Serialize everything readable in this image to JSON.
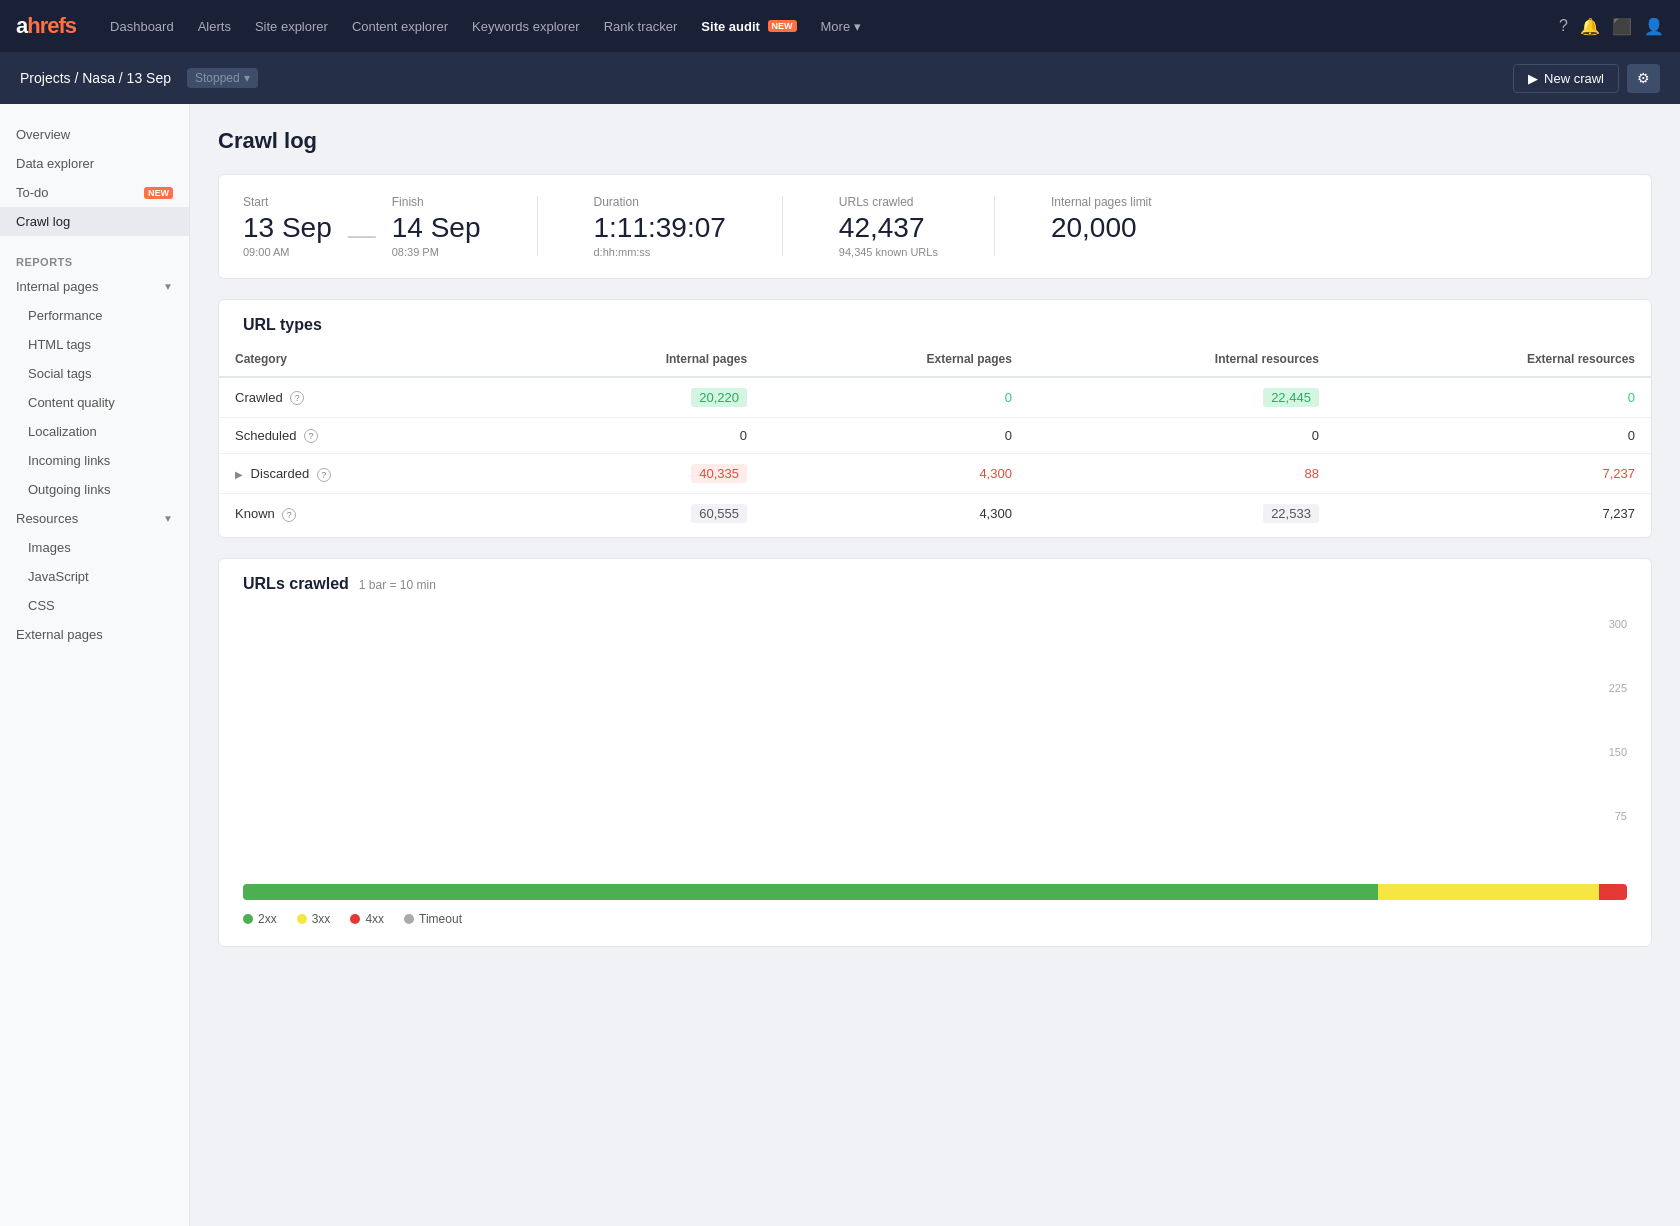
{
  "nav": {
    "logo": "ahrefs",
    "links": [
      {
        "label": "Dashboard",
        "active": false
      },
      {
        "label": "Alerts",
        "active": false
      },
      {
        "label": "Site explorer",
        "active": false
      },
      {
        "label": "Content explorer",
        "active": false
      },
      {
        "label": "Keywords explorer",
        "active": false
      },
      {
        "label": "Rank tracker",
        "active": false
      },
      {
        "label": "Site audit",
        "active": true,
        "badge": "NEW"
      },
      {
        "label": "More",
        "active": false,
        "hasArrow": true
      }
    ]
  },
  "subheader": {
    "breadcrumb_projects": "Projects",
    "breadcrumb_sep1": " / ",
    "breadcrumb_nasa": "Nasa",
    "breadcrumb_sep2": " / ",
    "breadcrumb_date": "13 Sep",
    "status": "Stopped",
    "new_crawl_label": "New crawl",
    "settings_icon": "⚙"
  },
  "sidebar": {
    "items": [
      {
        "label": "Overview",
        "type": "item"
      },
      {
        "label": "Data explorer",
        "type": "item"
      },
      {
        "label": "To-do",
        "type": "item",
        "badge": "NEW"
      },
      {
        "label": "Crawl log",
        "type": "item",
        "active": true
      },
      {
        "label": "REPORTS",
        "type": "section"
      },
      {
        "label": "Internal pages",
        "type": "group",
        "expanded": true
      },
      {
        "label": "Performance",
        "type": "subitem"
      },
      {
        "label": "HTML tags",
        "type": "subitem"
      },
      {
        "label": "Social tags",
        "type": "subitem"
      },
      {
        "label": "Content quality",
        "type": "subitem"
      },
      {
        "label": "Localization",
        "type": "subitem"
      },
      {
        "label": "Incoming links",
        "type": "subitem"
      },
      {
        "label": "Outgoing links",
        "type": "subitem"
      },
      {
        "label": "Resources",
        "type": "group",
        "expanded": true
      },
      {
        "label": "Images",
        "type": "subitem"
      },
      {
        "label": "JavaScript",
        "type": "subitem"
      },
      {
        "label": "CSS",
        "type": "subitem"
      },
      {
        "label": "External pages",
        "type": "item"
      }
    ]
  },
  "page": {
    "title": "Crawl log",
    "crawl_stats": {
      "start_label": "Start",
      "start_value": "13 Sep",
      "start_time": "09:00 AM",
      "dash": "—",
      "finish_label": "Finish",
      "finish_value": "14 Sep",
      "finish_time": "08:39 PM",
      "duration_label": "Duration",
      "duration_value": "1:11:39:07",
      "duration_sub": "d:hh:mm:ss",
      "urls_label": "URLs crawled",
      "urls_value": "42,437",
      "urls_sub": "94,345 known URLs",
      "limit_label": "Internal pages limit",
      "limit_value": "20,000"
    },
    "url_types": {
      "title": "URL types",
      "columns": [
        "Category",
        "Internal pages",
        "External pages",
        "Internal resources",
        "External resources"
      ],
      "rows": [
        {
          "category": "Crawled",
          "internal_pages": "20,220",
          "internal_pages_style": "green-light",
          "external_pages": "0",
          "external_pages_style": "green",
          "internal_resources": "22,445",
          "internal_resources_style": "green-light",
          "external_resources": "0",
          "external_resources_style": "green"
        },
        {
          "category": "Scheduled",
          "internal_pages": "0",
          "internal_pages_style": "normal",
          "external_pages": "0",
          "external_pages_style": "normal",
          "internal_resources": "0",
          "internal_resources_style": "normal",
          "external_resources": "0",
          "external_resources_style": "normal"
        },
        {
          "category": "Discarded",
          "expandable": true,
          "internal_pages": "40,335",
          "internal_pages_style": "red-bg",
          "external_pages": "4,300",
          "external_pages_style": "red",
          "internal_resources": "88",
          "internal_resources_style": "red",
          "external_resources": "7,237",
          "external_resources_style": "red"
        },
        {
          "category": "Known",
          "internal_pages": "60,555",
          "internal_pages_style": "gray-bg",
          "external_pages": "4,300",
          "external_pages_style": "normal",
          "internal_resources": "22,533",
          "internal_resources_style": "gray-bg",
          "external_resources": "7,237",
          "external_resources_style": "normal"
        }
      ]
    },
    "chart": {
      "title": "URLs crawled",
      "subtitle": "1 bar = 10 min",
      "y_labels": [
        "300",
        "225",
        "150",
        "75",
        ""
      ],
      "legend": [
        {
          "label": "2xx",
          "color": "#4caf50"
        },
        {
          "label": "3xx",
          "color": "#f5e642"
        },
        {
          "label": "4xx",
          "color": "#e53935"
        },
        {
          "label": "Timeout",
          "color": "#aaa"
        }
      ],
      "progress_bar": [
        {
          "color": "#4caf50",
          "width": 82
        },
        {
          "color": "#f5e642",
          "width": 16
        },
        {
          "color": "#e53935",
          "width": 2
        }
      ]
    }
  }
}
